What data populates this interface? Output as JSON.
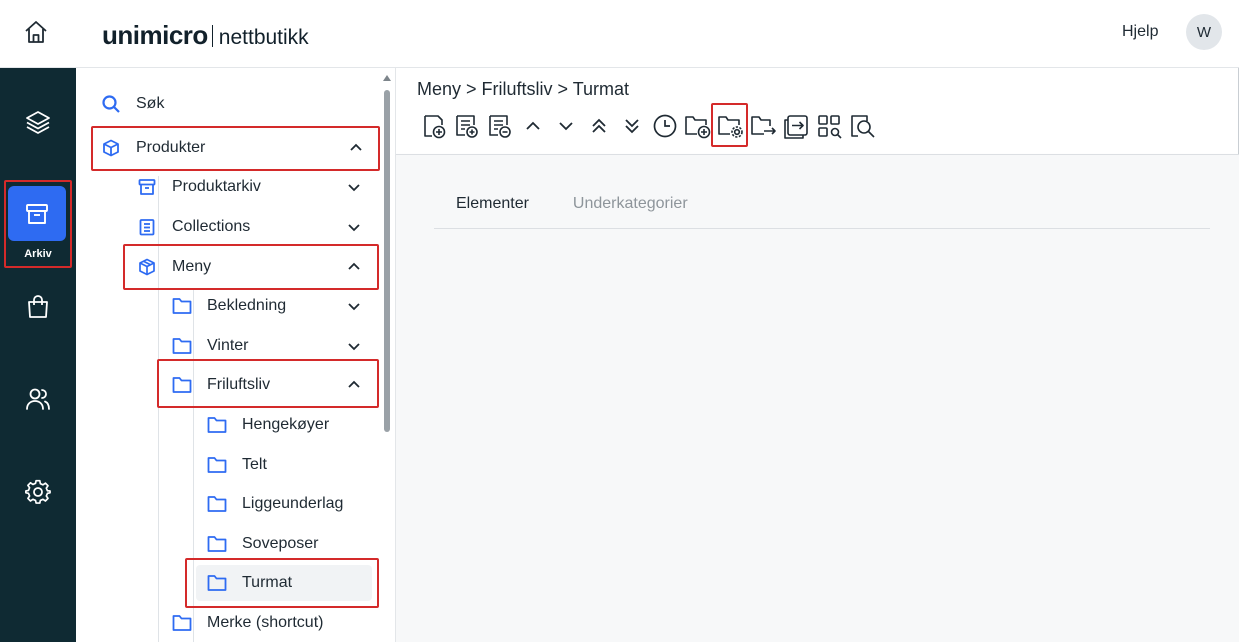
{
  "header": {
    "logo_main": "unimicro",
    "logo_sub": "nettbutikk",
    "help": "Hjelp",
    "avatar_initial": "W"
  },
  "rail": {
    "active_label": "Arkiv",
    "items": [
      "home-icon",
      "layers-icon",
      "archive-icon",
      "shopping-bag-icon",
      "users-icon",
      "gear-icon"
    ]
  },
  "tree": {
    "search": "Søk",
    "produkter": "Produkter",
    "produktarkiv": "Produktarkiv",
    "collections": "Collections",
    "meny": "Meny",
    "bekledning": "Bekledning",
    "vinter": "Vinter",
    "friluftsliv": "Friluftsliv",
    "hengekoyer": "Hengekøyer",
    "telt": "Telt",
    "liggeunderlag": "Liggeunderlag",
    "soveposer": "Soveposer",
    "turmat": "Turmat",
    "merke": "Merke (shortcut)"
  },
  "main": {
    "breadcrumb": "Meny > Friluftsliv > Turmat",
    "tabs": [
      "Elementer",
      "Underkategorier"
    ],
    "active_tab": "Elementer"
  },
  "colors": {
    "rail_bg": "#0f2a33",
    "accent": "#2e6bf2",
    "highlight": "#d42a2a"
  }
}
